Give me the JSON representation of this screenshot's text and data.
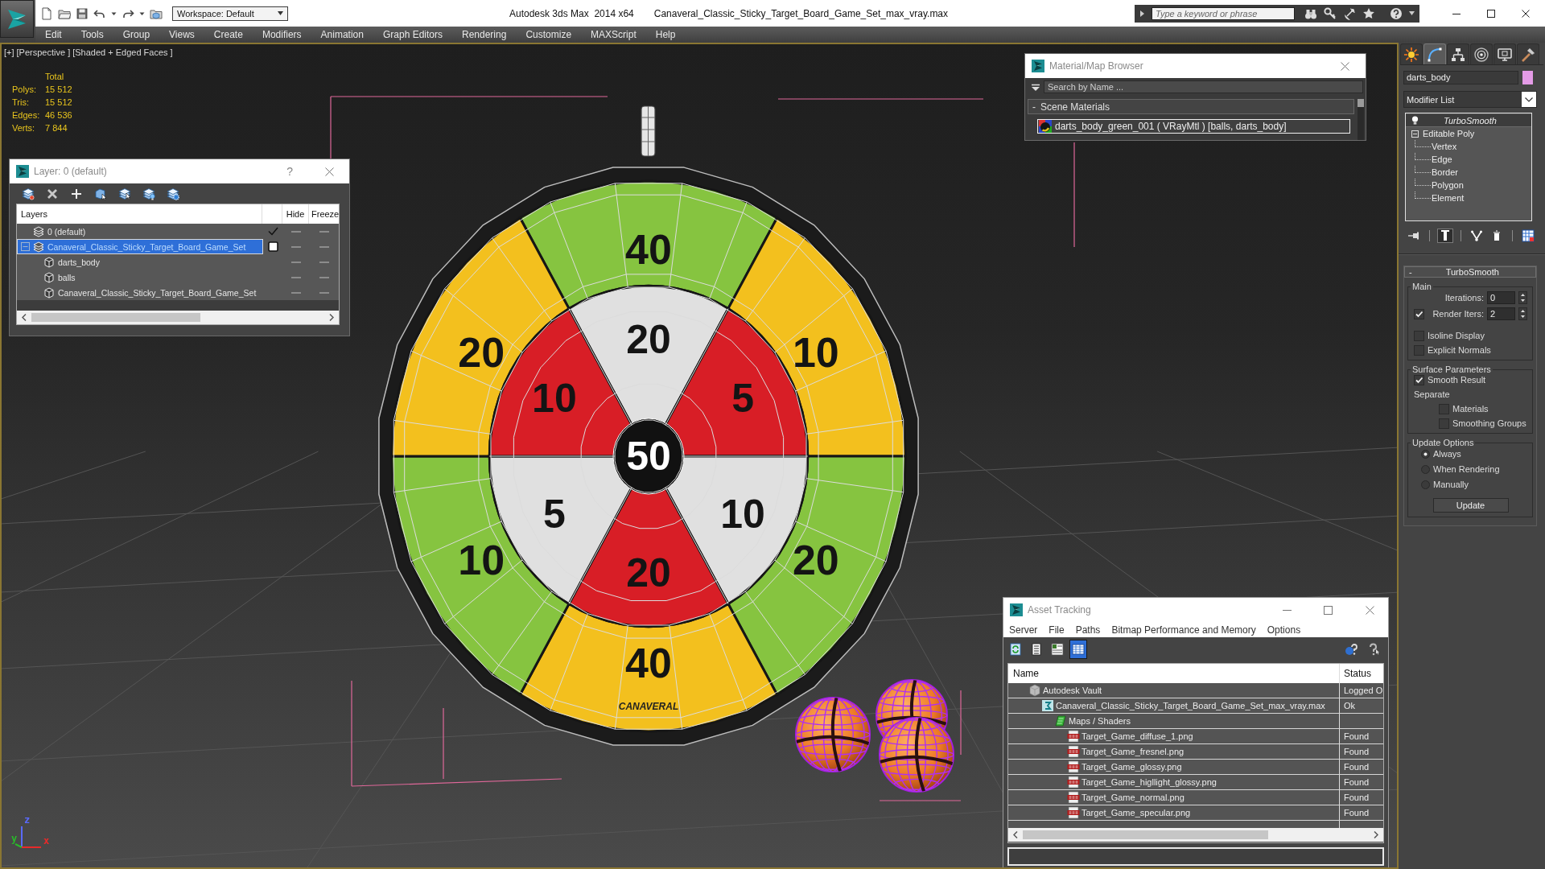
{
  "titlebar": {
    "workspace": "Workspace: Default",
    "app_title": "Autodesk 3ds Max  2014 x64",
    "file_name": "Canaveral_Classic_Sticky_Target_Board_Game_Set_max_vray.max",
    "search": {
      "placeholder": "Type a keyword or phrase"
    }
  },
  "menu": [
    "Edit",
    "Tools",
    "Group",
    "Views",
    "Create",
    "Modifiers",
    "Animation",
    "Graph Editors",
    "Rendering",
    "Customize",
    "MAXScript",
    "Help"
  ],
  "viewport": {
    "labels": [
      "[+]",
      "[Perspective ]",
      "[Shaded + Edged Faces ]"
    ],
    "stats": {
      "heading": "Total",
      "rows": [
        {
          "label": "Polys:",
          "value": "15 512"
        },
        {
          "label": "Tris:",
          "value": "15 512"
        },
        {
          "label": "Edges:",
          "value": "46 536"
        },
        {
          "label": "Verts:",
          "value": "7 844"
        }
      ]
    },
    "board": {
      "outer_ring": [
        {
          "label": "40",
          "color": "#86c440"
        },
        {
          "label": "10",
          "color": "#f3c01e"
        },
        {
          "label": "20",
          "color": "#86c440"
        },
        {
          "label": "40",
          "color": "#f3c01e"
        },
        {
          "label": "10",
          "color": "#86c440"
        },
        {
          "label": "20",
          "color": "#f3c01e"
        }
      ],
      "inner_ring": [
        {
          "label": "20",
          "color": "#e0e0e0"
        },
        {
          "label": "5",
          "color": "#d81e26"
        },
        {
          "label": "10",
          "color": "#e0e0e0"
        },
        {
          "label": "20",
          "color": "#d81e26"
        },
        {
          "label": "5",
          "color": "#e0e0e0"
        },
        {
          "label": "10",
          "color": "#d81e26"
        }
      ],
      "bull": "50",
      "brand": "CANAVERAL"
    },
    "axes": [
      {
        "label": "z",
        "color": "#5a6aff"
      },
      {
        "label": "y",
        "color": "#2ab82a"
      },
      {
        "label": "x",
        "color": "#e82a2a"
      }
    ]
  },
  "layer_dialog": {
    "title": "Layer: 0 (default)",
    "help": "?",
    "columns": [
      "Layers",
      "Hide",
      "Freeze"
    ],
    "layers": [
      {
        "kind": "layer",
        "name": "0 (default)",
        "selected": false,
        "current": true,
        "hidden": false,
        "frozen": false
      },
      {
        "kind": "layer",
        "name": "Canaveral_Classic_Sticky_Target_Board_Game_Set",
        "selected": true,
        "current": false,
        "expanded": true,
        "hidden": false,
        "frozen": false,
        "children": [
          {
            "kind": "object",
            "name": "darts_body",
            "selected": false,
            "hidden": false,
            "frozen": false
          },
          {
            "kind": "object",
            "name": "balls",
            "selected": false,
            "hidden": false,
            "frozen": false
          },
          {
            "kind": "object",
            "name": "Canaveral_Classic_Sticky_Target_Board_Game_Set",
            "selected": false,
            "hidden": false,
            "frozen": false
          }
        ]
      }
    ]
  },
  "material_browser": {
    "title": "Material/Map Browser",
    "search": {
      "placeholder": "Search by Name ..."
    },
    "groups": [
      {
        "toggle": "-",
        "title": "Scene Materials",
        "materials": [
          {
            "name": "darts_body_green_001 ( VRayMtl ) [balls, darts_body]",
            "selected": true
          }
        ]
      }
    ]
  },
  "asset_tracking": {
    "title": "Asset Tracking",
    "menu": [
      "Server",
      "File",
      "Paths",
      "Bitmap Performance and Memory",
      "Options"
    ],
    "toolbar": [
      {
        "pressed": false
      },
      {
        "pressed": false
      },
      {
        "pressed": false
      },
      {
        "pressed": true
      }
    ],
    "columns": [
      "Name",
      "Status"
    ],
    "assets": [
      {
        "kind": "vault",
        "name": "Autodesk Vault",
        "status": "Logged O",
        "selected": false,
        "children": [
          {
            "kind": "scene",
            "name": "Canaveral_Classic_Sticky_Target_Board_Game_Set_max_vray.max",
            "status": "Ok",
            "selected": false,
            "children": [
              {
                "kind": "folder",
                "name": "Maps / Shaders",
                "selected": false,
                "children": [
                  {
                    "kind": "image",
                    "name": "Target_Game_diffuse_1.png",
                    "status": "Found",
                    "selected": false
                  },
                  {
                    "kind": "image",
                    "name": "Target_Game_fresnel.png",
                    "status": "Found",
                    "selected": false
                  },
                  {
                    "kind": "image",
                    "name": "Target_Game_glossy.png",
                    "status": "Found",
                    "selected": false
                  },
                  {
                    "kind": "image",
                    "name": "Target_Game_higllight_glossy.png",
                    "status": "Found",
                    "selected": false
                  },
                  {
                    "kind": "image",
                    "name": "Target_Game_normal.png",
                    "status": "Found",
                    "selected": false
                  },
                  {
                    "kind": "image",
                    "name": "Target_Game_specular.png",
                    "status": "Found",
                    "selected": false
                  }
                ]
              }
            ]
          }
        ]
      }
    ]
  },
  "command_panel": {
    "tabs": [
      {
        "selected": false
      },
      {
        "selected": true
      },
      {
        "selected": false
      },
      {
        "selected": false
      },
      {
        "selected": false
      },
      {
        "selected": false
      }
    ],
    "object": {
      "name": "darts_body",
      "color": "#e49be6"
    },
    "modifier_list": "Modifier List",
    "stack": [
      {
        "kind": "modifier",
        "name": "TurboSmooth",
        "enabled": true,
        "selected": true
      },
      {
        "kind": "base",
        "name": "Editable Poly",
        "expanded": true,
        "selected": false,
        "children": [
          {
            "kind": "subobject",
            "name": "Vertex",
            "selected": false
          },
          {
            "kind": "subobject",
            "name": "Edge",
            "selected": false
          },
          {
            "kind": "subobject",
            "name": "Border",
            "selected": false
          },
          {
            "kind": "subobject",
            "name": "Polygon",
            "selected": false
          },
          {
            "kind": "subobject",
            "name": "Element",
            "selected": false
          }
        ]
      }
    ],
    "stack_tools": [
      {
        "pressed": false
      },
      {
        "pressed": true
      },
      {
        "pressed": false
      },
      {
        "pressed": false
      },
      {
        "pressed": false
      }
    ],
    "rollout": {
      "toggle": "-",
      "title": "TurboSmooth",
      "groups": [
        {
          "title": "Main",
          "controls": [
            {
              "kind": "spinner",
              "label": "Iterations:",
              "value": "0"
            },
            {
              "kind": "spinner",
              "label": "Render Iters:",
              "value": "2",
              "checked": true
            },
            {
              "kind": "checkbox",
              "label": "Isoline Display",
              "checked": false
            },
            {
              "kind": "checkbox",
              "label": "Explicit Normals",
              "checked": false
            }
          ]
        },
        {
          "title": "Surface Parameters",
          "controls": [
            {
              "kind": "checkbox",
              "label": "Smooth Result",
              "checked": true
            },
            {
              "kind": "label",
              "label": "Separate",
              "children": [
                {
                  "kind": "checkbox",
                  "label": "Materials",
                  "checked": false
                },
                {
                  "kind": "checkbox",
                  "label": "Smoothing Groups",
                  "checked": false
                }
              ]
            }
          ]
        },
        {
          "title": "Update Options",
          "controls": [
            {
              "kind": "radio",
              "label": "Always",
              "selected": true
            },
            {
              "kind": "radio",
              "label": "When Rendering",
              "selected": false
            },
            {
              "kind": "radio",
              "label": "Manually",
              "selected": false
            },
            {
              "kind": "button",
              "label": "Update"
            }
          ]
        }
      ]
    }
  }
}
